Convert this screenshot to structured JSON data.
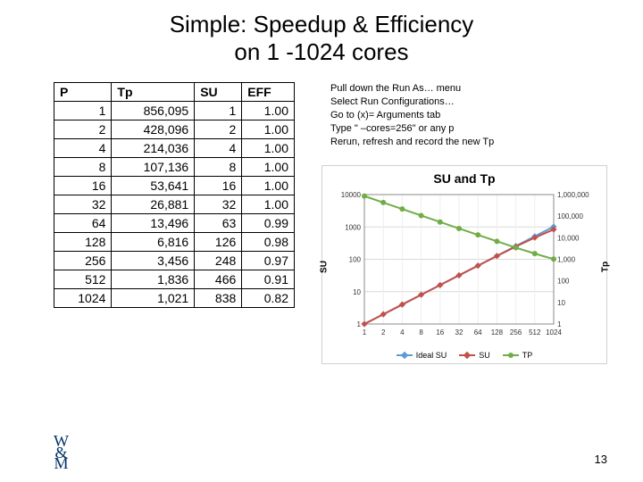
{
  "title_line1": "Simple: Speedup & Efficiency",
  "title_line2": "on 1 -1024 cores",
  "instructions": [
    "Pull down the Run As… menu",
    "Select Run Configurations…",
    "Go to (x)= Arguments tab",
    "Type \" –cores=256\" or any p",
    "Rerun, refresh and record the new Tp"
  ],
  "table": {
    "headers": [
      "P",
      "Tp",
      "SU",
      "EFF"
    ],
    "rows": [
      [
        1,
        "856,095",
        1,
        "1.00"
      ],
      [
        2,
        "428,096",
        2,
        "1.00"
      ],
      [
        4,
        "214,036",
        4,
        "1.00"
      ],
      [
        8,
        "107,136",
        8,
        "1.00"
      ],
      [
        16,
        "53,641",
        16,
        "1.00"
      ],
      [
        32,
        "26,881",
        32,
        "1.00"
      ],
      [
        64,
        "13,496",
        63,
        "0.99"
      ],
      [
        128,
        "6,816",
        126,
        "0.98"
      ],
      [
        256,
        "3,456",
        248,
        "0.97"
      ],
      [
        512,
        "1,836",
        466,
        "0.91"
      ],
      [
        1024,
        "1,021",
        838,
        "0.82"
      ]
    ]
  },
  "chart_data": {
    "type": "line",
    "title": "SU and Tp",
    "xlabel": "",
    "ylabel_left": "SU",
    "ylabel_right": "Tp",
    "x_categories": [
      1,
      2,
      4,
      8,
      16,
      32,
      64,
      128,
      256,
      512,
      1024
    ],
    "y_left_ticks": [
      1,
      10,
      100,
      1000,
      10000
    ],
    "y_right_ticks": [
      1,
      10,
      100,
      1000,
      10000,
      100000,
      1000000
    ],
    "y_left_range": [
      1,
      10000
    ],
    "y_right_range": [
      1,
      1000000
    ],
    "series": [
      {
        "name": "Ideal SU",
        "axis": "left",
        "color": "#5b9bd5",
        "values": [
          1,
          2,
          4,
          8,
          16,
          32,
          64,
          128,
          256,
          512,
          1024
        ]
      },
      {
        "name": "SU",
        "axis": "left",
        "color": "#c5504b",
        "values": [
          1,
          2,
          4,
          8,
          16,
          32,
          63,
          126,
          248,
          466,
          838
        ]
      },
      {
        "name": "TP",
        "axis": "right",
        "color": "#71ad47",
        "values": [
          856095,
          428096,
          214036,
          107136,
          53641,
          26881,
          13496,
          6816,
          3456,
          1836,
          1021
        ]
      }
    ],
    "legend": [
      "Ideal SU",
      "SU",
      "TP"
    ]
  },
  "page_number": "13"
}
